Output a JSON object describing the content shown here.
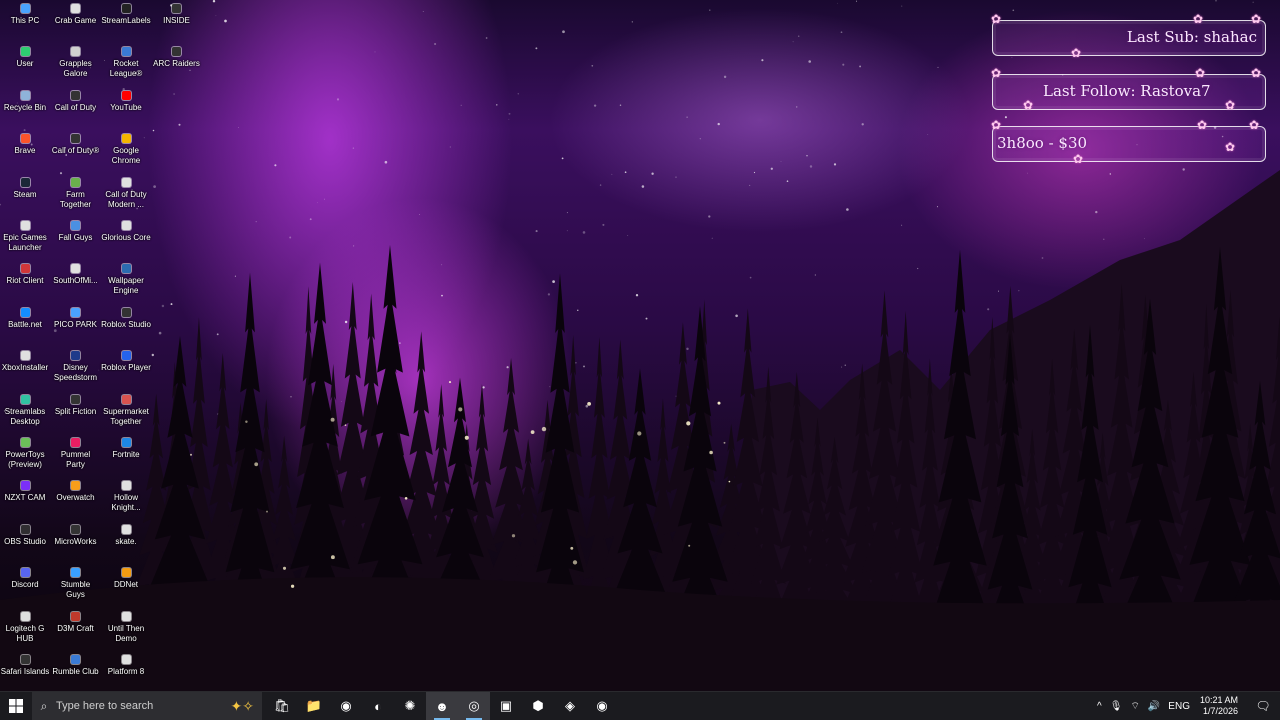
{
  "desktop_icons": [
    {
      "label": "This PC",
      "col": 0,
      "row": 0,
      "color": "#4aa3ff"
    },
    {
      "label": "Crab Game",
      "col": 1,
      "row": 0,
      "color": "#e0e0e0"
    },
    {
      "label": "StreamLabels",
      "col": 2,
      "row": 0,
      "color": "#222222"
    },
    {
      "label": "INSIDE",
      "col": 3,
      "row": 0,
      "color": "#333333"
    },
    {
      "label": "User",
      "col": 0,
      "row": 1,
      "color": "#2ecc71"
    },
    {
      "label": "Grapples Galore",
      "col": 1,
      "row": 1,
      "color": "#d0d0d0"
    },
    {
      "label": "Rocket League®",
      "col": 2,
      "row": 1,
      "color": "#3a7bd5"
    },
    {
      "label": "ARC Raiders",
      "col": 3,
      "row": 1,
      "color": "#333333"
    },
    {
      "label": "Recycle Bin",
      "col": 0,
      "row": 2,
      "color": "#8fb3d9"
    },
    {
      "label": "Call of Duty",
      "col": 1,
      "row": 2,
      "color": "#333333"
    },
    {
      "label": "YouTube",
      "col": 2,
      "row": 2,
      "color": "#ff0000"
    },
    {
      "label": "Brave",
      "col": 0,
      "row": 3,
      "color": "#fb542b"
    },
    {
      "label": "Call of Duty®",
      "col": 1,
      "row": 3,
      "color": "#333333"
    },
    {
      "label": "Google Chrome",
      "col": 2,
      "row": 3,
      "color": "#f4b400"
    },
    {
      "label": "Steam",
      "col": 0,
      "row": 4,
      "color": "#1b2838"
    },
    {
      "label": "Farm Together",
      "col": 1,
      "row": 4,
      "color": "#6ab04c"
    },
    {
      "label": "Call of Duty Modern ...",
      "col": 2,
      "row": 4,
      "color": "#e0e0e0"
    },
    {
      "label": "Epic Games Launcher",
      "col": 0,
      "row": 5,
      "color": "#e0e0e0"
    },
    {
      "label": "Fall Guys",
      "col": 1,
      "row": 5,
      "color": "#4a90e2"
    },
    {
      "label": "Glorious Core",
      "col": 2,
      "row": 5,
      "color": "#e0e0e0"
    },
    {
      "label": "Riot Client",
      "col": 0,
      "row": 6,
      "color": "#d13639"
    },
    {
      "label": "SouthOfMi...",
      "col": 1,
      "row": 6,
      "color": "#e0e0e0"
    },
    {
      "label": "Wallpaper Engine",
      "col": 2,
      "row": 6,
      "color": "#2b6cb0"
    },
    {
      "label": "Battle.net",
      "col": 0,
      "row": 7,
      "color": "#148eff"
    },
    {
      "label": "PICO PARK",
      "col": 1,
      "row": 7,
      "color": "#4aa3ff"
    },
    {
      "label": "Roblox Studio",
      "col": 2,
      "row": 7,
      "color": "#333333"
    },
    {
      "label": "XboxInstaller",
      "col": 0,
      "row": 8,
      "color": "#e0e0e0"
    },
    {
      "label": "Disney Speedstorm",
      "col": 1,
      "row": 8,
      "color": "#1e3a8a"
    },
    {
      "label": "Roblox Player",
      "col": 2,
      "row": 8,
      "color": "#2563eb"
    },
    {
      "label": "Streamlabs Desktop",
      "col": 0,
      "row": 9,
      "color": "#31c3a2"
    },
    {
      "label": "Split Fiction",
      "col": 1,
      "row": 9,
      "color": "#333333"
    },
    {
      "label": "Supermarket Together",
      "col": 2,
      "row": 9,
      "color": "#d9534f"
    },
    {
      "label": "PowerToys (Preview)",
      "col": 0,
      "row": 10,
      "color": "#6bbf59"
    },
    {
      "label": "Pummel Party",
      "col": 1,
      "row": 10,
      "color": "#e91e63"
    },
    {
      "label": "Fortnite",
      "col": 2,
      "row": 10,
      "color": "#1e88e5"
    },
    {
      "label": "NZXT CAM",
      "col": 0,
      "row": 11,
      "color": "#7b2ff7"
    },
    {
      "label": "Overwatch",
      "col": 1,
      "row": 11,
      "color": "#f99e1a"
    },
    {
      "label": "Hollow Knight...",
      "col": 2,
      "row": 11,
      "color": "#e0e0e0"
    },
    {
      "label": "OBS Studio",
      "col": 0,
      "row": 12,
      "color": "#302e31"
    },
    {
      "label": "MicroWorks",
      "col": 1,
      "row": 12,
      "color": "#333333"
    },
    {
      "label": "skate.",
      "col": 2,
      "row": 12,
      "color": "#e0e0e0"
    },
    {
      "label": "Discord",
      "col": 0,
      "row": 13,
      "color": "#5865f2"
    },
    {
      "label": "Stumble Guys",
      "col": 1,
      "row": 13,
      "color": "#3aa0ff"
    },
    {
      "label": "DDNet",
      "col": 2,
      "row": 13,
      "color": "#f39c12"
    },
    {
      "label": "Logitech G HUB",
      "col": 0,
      "row": 14,
      "color": "#e0e0e0"
    },
    {
      "label": "D3M Craft",
      "col": 1,
      "row": 14,
      "color": "#c0392b"
    },
    {
      "label": "Until Then Demo",
      "col": 2,
      "row": 14,
      "color": "#e0e0e0"
    },
    {
      "label": "Safari Islands",
      "col": 0,
      "row": 15,
      "color": "#333333"
    },
    {
      "label": "Rumble Club",
      "col": 1,
      "row": 15,
      "color": "#3a7bd5"
    },
    {
      "label": "Platform 8",
      "col": 2,
      "row": 15,
      "color": "#e0e0e0"
    }
  ],
  "widgets": {
    "last_sub": "Last Sub: shahac",
    "last_follow": "Last Follow: Rastova7",
    "donation": "3h8oo - $30"
  },
  "taskbar": {
    "search_placeholder": "Type here to search",
    "apps": [
      {
        "name": "microsoft-store-icon",
        "glyph": "🛍",
        "active": false
      },
      {
        "name": "file-explorer-icon",
        "glyph": "📁",
        "active": false
      },
      {
        "name": "chrome-icon",
        "glyph": "◉",
        "active": false
      },
      {
        "name": "edge-icon",
        "glyph": "◐",
        "active": false
      },
      {
        "name": "steelseries-icon",
        "glyph": "✺",
        "active": false
      },
      {
        "name": "discord-icon",
        "glyph": "☻",
        "active": true
      },
      {
        "name": "obs-icon",
        "glyph": "◎",
        "active": true
      },
      {
        "name": "minecraft-icon",
        "glyph": "▣",
        "active": false
      },
      {
        "name": "app-cube-icon",
        "glyph": "⬢",
        "active": false
      },
      {
        "name": "nvidia-icon",
        "glyph": "◈",
        "active": false
      },
      {
        "name": "chrome-alt-icon",
        "glyph": "◉",
        "active": false
      }
    ],
    "language": "ENG",
    "time": "10:21 AM",
    "date": "1/7/2026"
  }
}
